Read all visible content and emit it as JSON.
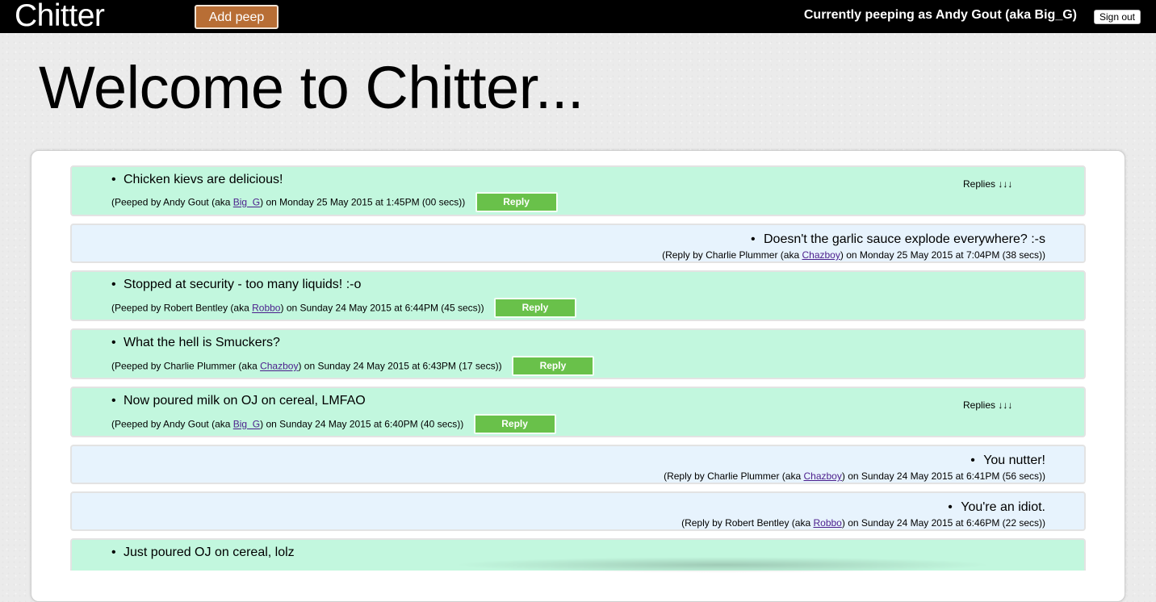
{
  "header": {
    "logo": "Chitter",
    "add_peep": "Add peep",
    "current_user": "Currently peeping as Andy Gout (aka Big_G)",
    "sign_out": "Sign out"
  },
  "welcome": "Welcome to Chitter...",
  "feed": [
    {
      "kind": "peep",
      "text": "Chicken kievs are delicious!",
      "meta_prefix": "(Peeped by Andy Gout (aka ",
      "handle": "Big_G",
      "meta_suffix": ") on Monday 25 May 2015 at 1:45PM (00 secs))",
      "reply_label": "Reply",
      "replies_label": "Replies ↓↓↓"
    },
    {
      "kind": "reply",
      "text": "Doesn't the garlic sauce explode everywhere? :-s",
      "meta_prefix": "(Reply by Charlie Plummer (aka ",
      "handle": "Chazboy",
      "meta_suffix": ") on Monday 25 May 2015 at 7:04PM (38 secs))"
    },
    {
      "kind": "peep",
      "text": "Stopped at security - too many liquids! :-o",
      "meta_prefix": "(Peeped by Robert Bentley (aka ",
      "handle": "Robbo",
      "meta_suffix": ") on Sunday 24 May 2015 at 6:44PM (45 secs))",
      "reply_label": "Reply"
    },
    {
      "kind": "peep",
      "text": "What the hell is Smuckers?",
      "meta_prefix": "(Peeped by Charlie Plummer (aka ",
      "handle": "Chazboy",
      "meta_suffix": ") on Sunday 24 May 2015 at 6:43PM (17 secs))",
      "reply_label": "Reply"
    },
    {
      "kind": "peep",
      "text": "Now poured milk on OJ on cereal, LMFAO",
      "meta_prefix": "(Peeped by Andy Gout (aka ",
      "handle": "Big_G",
      "meta_suffix": ") on Sunday 24 May 2015 at 6:40PM (40 secs))",
      "reply_label": "Reply",
      "replies_label": "Replies ↓↓↓"
    },
    {
      "kind": "reply",
      "text": "You nutter!",
      "meta_prefix": "(Reply by Charlie Plummer (aka ",
      "handle": "Chazboy",
      "meta_suffix": ") on Sunday 24 May 2015 at 6:41PM (56 secs))"
    },
    {
      "kind": "reply",
      "text": "You're an idiot.",
      "meta_prefix": "(Reply by Robert Bentley (aka ",
      "handle": "Robbo",
      "meta_suffix": ") on Sunday 24 May 2015 at 6:46PM (22 secs))"
    },
    {
      "kind": "peep",
      "text": "Just poured OJ on cereal, lolz"
    }
  ],
  "colors": {
    "peep_bg": "#c2f7de",
    "reply_bg": "#e7f3fd",
    "reply_button": "#69c14a",
    "add_peep_button": "#b86e35",
    "topbar": "#000000"
  }
}
